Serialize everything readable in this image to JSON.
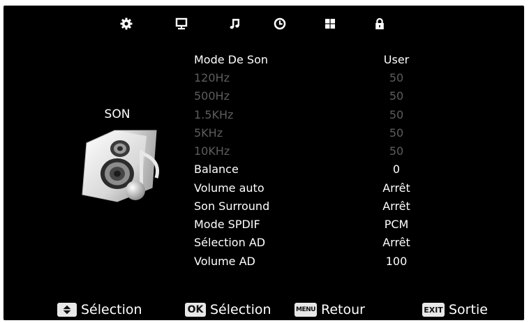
{
  "nav": {
    "tabs": [
      {
        "icon": "gear-icon",
        "selected": true
      },
      {
        "icon": "monitor-icon",
        "selected": false
      },
      {
        "icon": "music-note-icon",
        "selected": false
      },
      {
        "icon": "clock-icon",
        "selected": false
      },
      {
        "icon": "grid-icon",
        "selected": false
      },
      {
        "icon": "lock-icon",
        "selected": false
      }
    ]
  },
  "section": {
    "title": "SON",
    "illustration": "speaker-music-icon"
  },
  "menu": {
    "items": [
      {
        "label": "Mode De Son",
        "value": "User",
        "enabled": true
      },
      {
        "label": "120Hz",
        "value": "50",
        "enabled": false
      },
      {
        "label": "500Hz",
        "value": "50",
        "enabled": false
      },
      {
        "label": "1.5KHz",
        "value": "50",
        "enabled": false
      },
      {
        "label": "5KHz",
        "value": "50",
        "enabled": false
      },
      {
        "label": "10KHz",
        "value": "50",
        "enabled": false
      },
      {
        "label": "Balance",
        "value": "0",
        "enabled": true
      },
      {
        "label": "Volume auto",
        "value": "Arrêt",
        "enabled": true
      },
      {
        "label": "Son Surround",
        "value": "Arrêt",
        "enabled": true
      },
      {
        "label": "Mode SPDIF",
        "value": "PCM",
        "enabled": true
      },
      {
        "label": "Sélection AD",
        "value": "Arrêt",
        "enabled": true
      },
      {
        "label": "Volume AD",
        "value": "100",
        "enabled": true
      }
    ]
  },
  "footer": {
    "hints": [
      {
        "key": "up-down-arrow-icon",
        "label": "Sélection"
      },
      {
        "key": "OK",
        "label": "Sélection"
      },
      {
        "key": "MENU",
        "label": "Retour"
      },
      {
        "key": "EXIT",
        "label": "Sortie"
      }
    ]
  },
  "colors": {
    "background": "#000000",
    "text": "#ffffff",
    "disabled_text": "#5d5d5d",
    "key_background": "#e8e8e8"
  }
}
